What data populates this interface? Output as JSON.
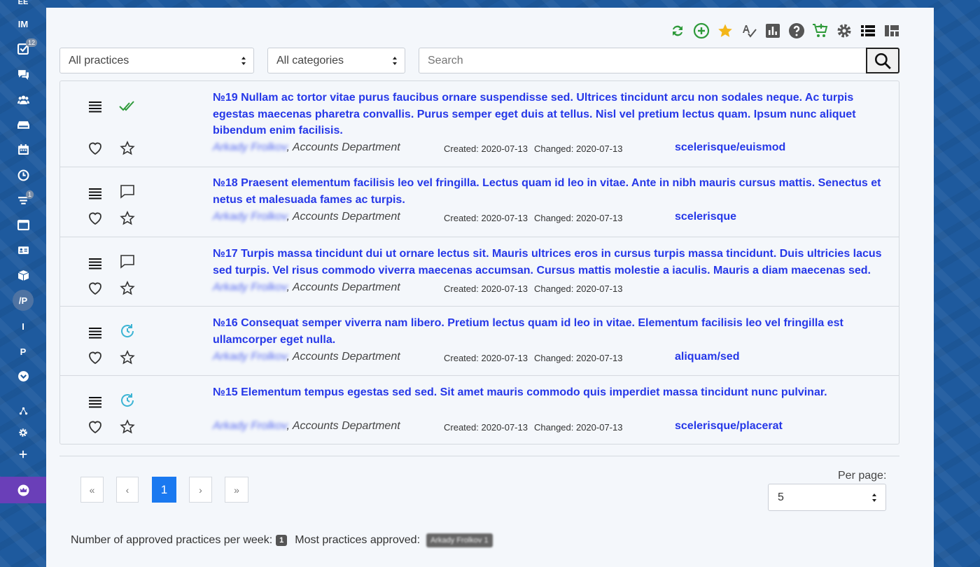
{
  "sidebar": {
    "items": [
      {
        "label": "IM"
      },
      {
        "badge": "12"
      },
      {
        "badge": "1"
      },
      {
        "label": "/P"
      },
      {
        "label": "I"
      },
      {
        "label": "P"
      }
    ]
  },
  "filters": {
    "practices": "All practices",
    "categories": "All categories",
    "search_placeholder": "Search"
  },
  "practices": [
    {
      "title": "№19 Nullam ac tortor vitae purus faucibus ornare suspendisse sed. Ultrices tincidunt arcu non sodales neque. Ac turpis egestas maecenas pharetra convallis. Purus semper eget duis at tellus. Nisl vel pretium lectus quam. Ipsum nunc aliquet bibendum enim facilisis.",
      "author": "Arkady Frolkov",
      "department": ", Accounts Department",
      "created": "Created: 2020-07-13",
      "changed": "Changed: 2020-07-13",
      "tag": "scelerisque/euismod",
      "status_icon": "double-check-icon"
    },
    {
      "title": "№18 Praesent elementum facilisis leo vel fringilla. Lectus quam id leo in vitae. Ante in nibh mauris cursus mattis. Senectus et netus et malesuada fames ac turpis.",
      "author": "Arkady Frolkov",
      "department": ", Accounts Department",
      "created": "Created: 2020-07-13",
      "changed": "Changed: 2020-07-13",
      "tag": "scelerisque",
      "status_icon": "comment-icon"
    },
    {
      "title": "№17 Turpis massa tincidunt dui ut ornare lectus sit. Mauris ultrices eros in cursus turpis massa tincidunt. Duis ultricies lacus sed turpis. Vel risus commodo viverra maecenas accumsan. Cursus mattis molestie a iaculis. Mauris a diam maecenas sed.",
      "author": "Arkady Frolkov",
      "department": ", Accounts Department",
      "created": "Created: 2020-07-13",
      "changed": "Changed: 2020-07-13",
      "tag": "",
      "status_icon": "comment-icon"
    },
    {
      "title": "№16 Consequat semper viverra nam libero. Pretium lectus quam id leo in vitae. Elementum facilisis leo vel fringilla est ullamcorper eget nulla.",
      "author": "Arkady Frolkov",
      "department": ", Accounts Department",
      "created": "Created: 2020-07-13",
      "changed": "Changed: 2020-07-13",
      "tag": "aliquam/sed",
      "status_icon": "refresh-clock-icon"
    },
    {
      "title": "№15 Elementum tempus egestas sed sed. Sit amet mauris commodo quis imperdiet massa tincidunt nunc pulvinar.",
      "author": "Arkady Frolkov",
      "department": ", Accounts Department",
      "created": "Created: 2020-07-13",
      "changed": "Changed: 2020-07-13",
      "tag": "scelerisque/placerat",
      "status_icon": "refresh-clock-icon"
    }
  ],
  "pagination": {
    "first": "«",
    "prev": "‹",
    "current": "1",
    "next": "›",
    "last": "»",
    "per_page_label": "Per page:",
    "per_page_value": "5"
  },
  "stats": {
    "approved_per_week_label": "Number of approved practices per week:",
    "approved_per_week_count": "1",
    "most_approved_label": "Most practices approved:",
    "most_approved_user": "Arkady Frolkov",
    "most_approved_count": "1"
  },
  "colors": {
    "accent": "#2638e8",
    "page_active": "#1a79f0",
    "green": "#2e9a3a",
    "teal": "#3cb4d4",
    "star": "#f3b619"
  }
}
